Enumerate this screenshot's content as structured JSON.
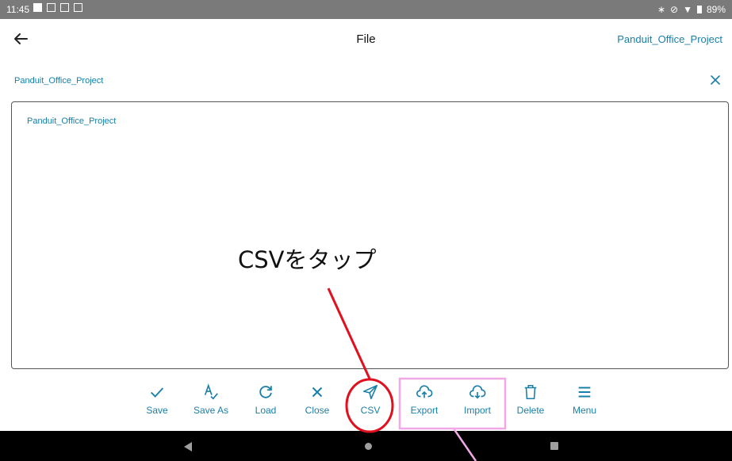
{
  "status_bar": {
    "time": "11:45",
    "battery": "89%"
  },
  "app_bar": {
    "title": "File",
    "project": "Panduit_Office_Project"
  },
  "file_header": {
    "name": "Panduit_Office_Project"
  },
  "file_list": {
    "items": [
      "Panduit_Office_Project"
    ]
  },
  "annotation": {
    "text": "CSVをタップ"
  },
  "toolbar": {
    "save": "Save",
    "save_as": "Save As",
    "load": "Load",
    "close": "Close",
    "csv": "CSV",
    "export": "Export",
    "import": "Import",
    "delete": "Delete",
    "menu": "Menu"
  },
  "colors": {
    "accent": "#1a7fa8",
    "annotation_red": "#e0101e",
    "annotation_pink": "#f0a8e6",
    "status_bar": "#7a7a7a",
    "nav_bar": "#000000"
  }
}
